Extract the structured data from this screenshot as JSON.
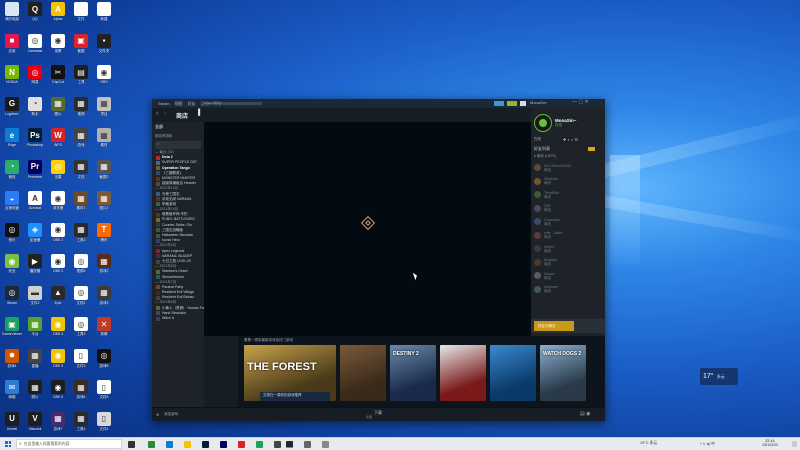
{
  "desktop": {
    "icons": [
      {
        "label": "我的电脑",
        "col": 0,
        "row": 0,
        "color": "#d9e6f5",
        "glyph": ""
      },
      {
        "label": "QQ",
        "col": 1,
        "row": 0,
        "color": "#1f1f1f",
        "glyph": "Q"
      },
      {
        "label": "Alpha",
        "col": 2,
        "row": 0,
        "color": "#f5c400",
        "glyph": "A"
      },
      {
        "label": "文件",
        "col": 3,
        "row": 0,
        "color": "#ffffff",
        "glyph": ""
      },
      {
        "label": "新建",
        "col": 4,
        "row": 0,
        "color": "#ffffff",
        "glyph": ""
      },
      {
        "label": "应用",
        "col": 0,
        "row": 1,
        "color": "#e4164d",
        "glyph": "■"
      },
      {
        "label": "Camtasia",
        "col": 1,
        "row": 1,
        "color": "#ffffff",
        "glyph": "◎"
      },
      {
        "label": "录屏",
        "col": 2,
        "row": 1,
        "color": "#ffffff",
        "glyph": "◉"
      },
      {
        "label": "截图",
        "col": 3,
        "row": 1,
        "color": "#d9252b",
        "glyph": "▣"
      },
      {
        "label": "文件夹",
        "col": 4,
        "row": 1,
        "color": "#222222",
        "glyph": "▪"
      },
      {
        "label": "NVIDIA",
        "col": 0,
        "row": 2,
        "color": "#76b900",
        "glyph": "N"
      },
      {
        "label": "网易",
        "col": 1,
        "row": 2,
        "color": "#e60012",
        "glyph": "◎"
      },
      {
        "label": "CapCut",
        "col": 2,
        "row": 2,
        "color": "#111111",
        "glyph": "✂"
      },
      {
        "label": "工具",
        "col": 3,
        "row": 2,
        "color": "#1e1e1e",
        "glyph": "▤"
      },
      {
        "label": "OBS",
        "col": 4,
        "row": 2,
        "color": "#ffffff",
        "glyph": "◉"
      },
      {
        "label": "Logitech",
        "col": 0,
        "row": 3,
        "color": "#1a1a1a",
        "glyph": "G"
      },
      {
        "label": "助手",
        "col": 1,
        "row": 3,
        "color": "#e0e0e0",
        "glyph": "◔"
      },
      {
        "label": "图片",
        "col": 2,
        "row": 3,
        "color": "#556b2f",
        "glyph": "▦"
      },
      {
        "label": "视频",
        "col": 3,
        "row": 3,
        "color": "#2a2a2a",
        "glyph": "▦"
      },
      {
        "label": "项目",
        "col": 4,
        "row": 3,
        "color": "#c0c0c0",
        "glyph": "▦"
      },
      {
        "label": "Edge",
        "col": 0,
        "row": 4,
        "color": "#0c7dd6",
        "glyph": "e"
      },
      {
        "label": "Photoshop",
        "col": 1,
        "row": 4,
        "color": "#001e36",
        "glyph": "Ps"
      },
      {
        "label": "WPS",
        "col": 2,
        "row": 4,
        "color": "#d82228",
        "glyph": "W"
      },
      {
        "label": "游戏",
        "col": 3,
        "row": 4,
        "color": "#444444",
        "glyph": "▦"
      },
      {
        "label": "素材",
        "col": 4,
        "row": 4,
        "color": "#b0b0b0",
        "glyph": "▦"
      },
      {
        "label": "微信",
        "col": 0,
        "row": 5,
        "color": "#2aae67",
        "glyph": "◔"
      },
      {
        "label": "Premiere",
        "col": 1,
        "row": 5,
        "color": "#00005b",
        "glyph": "Pr"
      },
      {
        "label": "迅雷",
        "col": 2,
        "row": 5,
        "color": "#ffd100",
        "glyph": "◎"
      },
      {
        "label": "文档",
        "col": 3,
        "row": 5,
        "color": "#333333",
        "glyph": "▦"
      },
      {
        "label": "截图2",
        "col": 4,
        "row": 5,
        "color": "#555555",
        "glyph": "▦"
      },
      {
        "label": "百度网盘",
        "col": 0,
        "row": 6,
        "color": "#2d7bf4",
        "glyph": "◒"
      },
      {
        "label": "Acrobat",
        "col": 1,
        "row": 6,
        "color": "#ffffff",
        "glyph": "A"
      },
      {
        "label": "浏览器",
        "col": 2,
        "row": 6,
        "color": "#ffffff",
        "glyph": "◉"
      },
      {
        "label": "素材2",
        "col": 3,
        "row": 6,
        "color": "#6b4c2a",
        "glyph": "▦"
      },
      {
        "label": "图片2",
        "col": 4,
        "row": 6,
        "color": "#7a5a3a",
        "glyph": "▦"
      },
      {
        "label": "音乐",
        "col": 0,
        "row": 7,
        "color": "#111111",
        "glyph": "◎"
      },
      {
        "label": "加速器",
        "col": 1,
        "row": 7,
        "color": "#1e90ff",
        "glyph": "◈"
      },
      {
        "label": "OBS 2",
        "col": 2,
        "row": 7,
        "color": "#ffffff",
        "glyph": "◉"
      },
      {
        "label": "工具2",
        "col": 3,
        "row": 7,
        "color": "#2a2a2a",
        "glyph": "▦"
      },
      {
        "label": "腾讯",
        "col": 4,
        "row": 7,
        "color": "#ff6a00",
        "glyph": "T"
      },
      {
        "label": "安全",
        "col": 0,
        "row": 8,
        "color": "#7ac142",
        "glyph": "◉"
      },
      {
        "label": "播放器",
        "col": 1,
        "row": 8,
        "color": "#222222",
        "glyph": "▶"
      },
      {
        "label": "OBS 3",
        "col": 2,
        "row": 8,
        "color": "#ffffff",
        "glyph": "◉"
      },
      {
        "label": "视频2",
        "col": 3,
        "row": 8,
        "color": "#ffffff",
        "glyph": "◎"
      },
      {
        "label": "游戏2",
        "col": 4,
        "row": 8,
        "color": "#5a2a1a",
        "glyph": "▦"
      },
      {
        "label": "Steam",
        "col": 0,
        "row": 9,
        "color": "#1b2838",
        "glyph": "◎"
      },
      {
        "label": "文件2",
        "col": 1,
        "row": 9,
        "color": "#cfcfcf",
        "glyph": "▬"
      },
      {
        "label": "Epic",
        "col": 2,
        "row": 9,
        "color": "#2a2a2a",
        "glyph": "▲"
      },
      {
        "label": "文档2",
        "col": 3,
        "row": 9,
        "color": "#ffffff",
        "glyph": "◎"
      },
      {
        "label": "游戏3",
        "col": 4,
        "row": 9,
        "color": "#3a3a3a",
        "glyph": "▦"
      },
      {
        "label": "GameViewer",
        "col": 0,
        "row": 10,
        "color": "#1aa260",
        "glyph": "▣"
      },
      {
        "label": "平台",
        "col": 1,
        "row": 10,
        "color": "#5aa02c",
        "glyph": "▦"
      },
      {
        "label": "OBS 4",
        "col": 2,
        "row": 10,
        "color": "#f5c400",
        "glyph": "◉"
      },
      {
        "label": "工具3",
        "col": 3,
        "row": 10,
        "color": "#ffffff",
        "glyph": "◎"
      },
      {
        "label": "剪辑",
        "col": 4,
        "row": 10,
        "color": "#c0392b",
        "glyph": "✕"
      },
      {
        "label": "游戏4",
        "col": 0,
        "row": 11,
        "color": "#d35400",
        "glyph": "✸"
      },
      {
        "label": "直播",
        "col": 1,
        "row": 11,
        "color": "#444444",
        "glyph": "▦"
      },
      {
        "label": "OBS 5",
        "col": 2,
        "row": 11,
        "color": "#f5c400",
        "glyph": "◉"
      },
      {
        "label": "文件3",
        "col": 3,
        "row": 11,
        "color": "#ffffff",
        "glyph": "▯"
      },
      {
        "label": "游戏5",
        "col": 4,
        "row": 11,
        "color": "#111111",
        "glyph": "◎"
      },
      {
        "label": "邮箱",
        "col": 0,
        "row": 12,
        "color": "#2e7bd6",
        "glyph": "✉"
      },
      {
        "label": "照片",
        "col": 1,
        "row": 12,
        "color": "#1e1e1e",
        "glyph": "▦"
      },
      {
        "label": "OBS 6",
        "col": 2,
        "row": 12,
        "color": "#1e1e1e",
        "glyph": "◉"
      },
      {
        "label": "游戏6",
        "col": 3,
        "row": 12,
        "color": "#3e2a1e",
        "glyph": "▦"
      },
      {
        "label": "文档3",
        "col": 4,
        "row": 12,
        "color": "#ffffff",
        "glyph": "▯"
      },
      {
        "label": "Unreal",
        "col": 0,
        "row": 13,
        "color": "#1e1e1e",
        "glyph": "U"
      },
      {
        "label": "Valorant",
        "col": 1,
        "row": 13,
        "color": "#1e1e1e",
        "glyph": "V"
      },
      {
        "label": "游戏7",
        "col": 2,
        "row": 13,
        "color": "#4a2a6a",
        "glyph": "▦"
      },
      {
        "label": "工具4",
        "col": 3,
        "row": 13,
        "color": "#2a2a2a",
        "glyph": "▦"
      },
      {
        "label": "文件4",
        "col": 4,
        "row": 13,
        "color": "#d9d9d9",
        "glyph": "▯"
      }
    ]
  },
  "steam": {
    "title_url": "steam://store",
    "menu": [
      "Steam",
      "视图",
      "好友",
      "游戏",
      "帮助"
    ],
    "nav_store": "商店",
    "user_name": "MooaSin~",
    "user_status": "在线",
    "library": {
      "search_label": "全部",
      "sort_label": "按名称排序",
      "rows": [
        {
          "type": "head",
          "text": "— 最近 (30)"
        },
        {
          "type": "game",
          "text": "Dota 2",
          "color": "#b02a2a",
          "bold": true
        },
        {
          "type": "game",
          "text": "SUPER PEOPLE CBT",
          "color": "#3a6a9a"
        },
        {
          "type": "game",
          "text": "Operation Tango",
          "color": "#7a5a2a",
          "bold": true
        },
        {
          "type": "game",
          "text": "《三國群英》",
          "color": "#2a4a7a"
        },
        {
          "type": "game",
          "text": "MONSTER HUNTER",
          "color": "#5a3a1a"
        },
        {
          "type": "game",
          "text": "超级商铺组合 Heavier",
          "color": "#4a4a4a"
        },
        {
          "type": "head",
          "text": "— 2021年11月"
        },
        {
          "type": "game",
          "text": "光荣三国志",
          "color": "#3a5a7a"
        },
        {
          "type": "game",
          "text": "永劫无间 NARAKA",
          "color": "#6a2a2a"
        },
        {
          "type": "game",
          "text": "甲裁游戏",
          "color": "#2a6a4a"
        },
        {
          "type": "head",
          "text": "— 2021年10月"
        },
        {
          "type": "game",
          "text": "暗黑破坏神 不朽",
          "color": "#4a3a2a"
        },
        {
          "type": "game",
          "text": "PUBG: BATTLEGRO",
          "color": "#7a6a3a"
        },
        {
          "type": "game",
          "text": "Counter-Strike: Glo",
          "color": "#2a3a4a"
        },
        {
          "type": "game",
          "text": "三国志战略版",
          "color": "#5a4a3a"
        },
        {
          "type": "game",
          "text": "Halloween Simulato",
          "color": "#3a5a3a"
        },
        {
          "type": "game",
          "text": "Iconic Hero",
          "color": "#3a3a6a"
        },
        {
          "type": "head",
          "text": "— 2021年9月"
        },
        {
          "type": "game",
          "text": "Apex Legends",
          "color": "#7a2a2a"
        },
        {
          "type": "game",
          "text": "NARAKA: BLADEP",
          "color": "#4a2a4a"
        },
        {
          "type": "game",
          "text": "七日之旅 LOGI-VE",
          "color": "#3a4a3a"
        },
        {
          "type": "head",
          "text": "— 2021年8月"
        },
        {
          "type": "game",
          "text": "Stardew's Onset",
          "color": "#5a6a2a"
        },
        {
          "type": "game",
          "text": "StressHeaven",
          "color": "#2a5a6a"
        },
        {
          "type": "head",
          "text": "— 2021年7月"
        },
        {
          "type": "game",
          "text": "Paranal Party",
          "color": "#6a4a2a"
        },
        {
          "type": "game",
          "text": "Resident Evil Village",
          "color": "#3a2a2a"
        },
        {
          "type": "game",
          "text": "Resident Evil Biohaz",
          "color": "#4a3a3a"
        },
        {
          "type": "head",
          "text": "— 2021年6月"
        },
        {
          "type": "game",
          "text": "小黄人（恶搞） Human Fall Flat",
          "color": "#6a5a3a"
        },
        {
          "type": "game",
          "text": "Hand Simulator",
          "color": "#3a4a5a"
        },
        {
          "type": "game",
          "text": "Witch It",
          "color": "#4a3a5a"
        }
      ],
      "add_game": "添加游戏"
    },
    "friends": {
      "title": "好友列表",
      "online_label": "在线",
      "group_label": "▾ 离线 (15/70)",
      "list": [
        {
          "name": "DOC5Dustin2019",
          "status": "离线",
          "color": "#5a4a3a"
        },
        {
          "name": "Stickmun",
          "status": "离线",
          "color": "#6a5a2a"
        },
        {
          "name": "TrinaRuki",
          "status": "离线",
          "color": "#3a5a3a"
        },
        {
          "name": "Q00",
          "status": "离线",
          "color": "#4a4a5a"
        },
        {
          "name": "Comedian",
          "status": "离线",
          "color": "#3a4a6a"
        },
        {
          "name": "ytrie - Dalex",
          "status": "离线",
          "color": "#5a3a3a"
        },
        {
          "name": "Stolen",
          "status": "离线",
          "color": "#3a3a3a"
        },
        {
          "name": "Muscrab",
          "status": "离线",
          "color": "#4a3a2a"
        },
        {
          "name": "Mouse",
          "status": "离线",
          "color": "#5a5a5a"
        },
        {
          "name": "Aimtimer",
          "status": "离线",
          "color": "#3a5a5a"
        }
      ],
      "chat_label": "好友与聊天"
    },
    "store": {
      "header": "看看一周前最新游戏及热门游戏",
      "caption": "交易在一周前的游戏推荐",
      "tiles": [
        {
          "title": "THE FOREST",
          "w": "wide",
          "color1": "#4a3a1a",
          "color2": "#c8a24a"
        },
        {
          "title": "",
          "w": "narrow",
          "color1": "#3a2a1a",
          "color2": "#7a5a3a"
        },
        {
          "title": "DESTINY 2",
          "w": "narrow",
          "color1": "#1a2a4a",
          "color2": "#6a8aaa"
        },
        {
          "title": "",
          "w": "narrow",
          "color1": "#7a1a1a",
          "color2": "#e8e8e8"
        },
        {
          "title": "",
          "w": "narrow",
          "color1": "#0a3a6a",
          "color2": "#3a8acf"
        },
        {
          "title": "WATCH DOGS 2",
          "w": "narrow",
          "color1": "#2a3a4a",
          "color2": "#8ab0cf"
        }
      ]
    },
    "bottom_center_1": "下载",
    "bottom_center_2": "管理"
  },
  "widget": {
    "temp": "17°",
    "label": "多云"
  },
  "taskbar": {
    "search_placeholder": "在这里输入你要搜索的内容",
    "weather": "19°C 多云",
    "time": "22:14",
    "date": "2021/11/23"
  }
}
